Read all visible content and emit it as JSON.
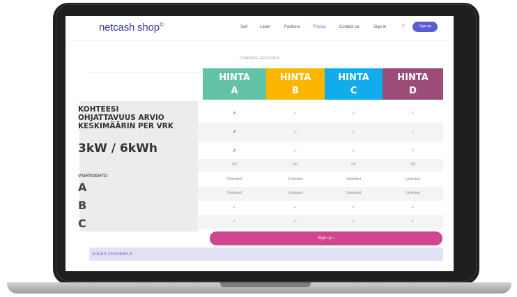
{
  "nav": {
    "logo": "netcash shop",
    "logo_mark": "©",
    "links": [
      "Sell",
      "Learn",
      "Partners",
      "Pricing",
      "Contact us",
      "Sign in"
    ],
    "active_link": "Pricing",
    "signup": "Sign up"
  },
  "compare_label": "COMPARE FEATURES",
  "columns": [
    {
      "line1": "HINTA",
      "line2": "A",
      "color": "#62c2a5"
    },
    {
      "line1": "HINTA",
      "line2": "B",
      "color": "#fbb600"
    },
    {
      "line1": "HINTA",
      "line2": "C",
      "color": "#12acec"
    },
    {
      "line1": "HINTA",
      "line2": "D",
      "color": "#9b4d77"
    }
  ],
  "panel": {
    "title_lines": [
      "KOHTEESI",
      "OHJATTAVUUS ARVIO",
      "KESKIMÄÄRIN PER VRK"
    ],
    "big": "3kW / 6kWh",
    "option_label": "VAIHTOEHTO",
    "options": [
      "A",
      "B",
      "C"
    ]
  },
  "rows": [
    {
      "cells": [
        "✗",
        "✓",
        "✓",
        "✓"
      ]
    },
    {
      "cells": [
        "✗",
        "✓",
        "✓",
        "✓"
      ]
    },
    {
      "cells": [
        "✗",
        "✓",
        "✓",
        "✓"
      ]
    },
    {
      "cells": [
        "R0",
        "R0",
        "R0",
        "R0"
      ]
    },
    {
      "cells": [
        "Unlimited",
        "Unlimited",
        "Unlimited",
        "Unlimited"
      ]
    },
    {
      "cells": [
        "Unlimited",
        "Unlimited",
        "Unlimited",
        "Unlimited"
      ]
    },
    {
      "cells": [
        "✓",
        "✓",
        "✓",
        "✓"
      ]
    },
    {
      "cells": [
        "✓",
        "✓",
        "✓",
        "✓"
      ]
    }
  ],
  "cta": "Sign up  ›",
  "sales_channels": "SALES CHANNELS"
}
